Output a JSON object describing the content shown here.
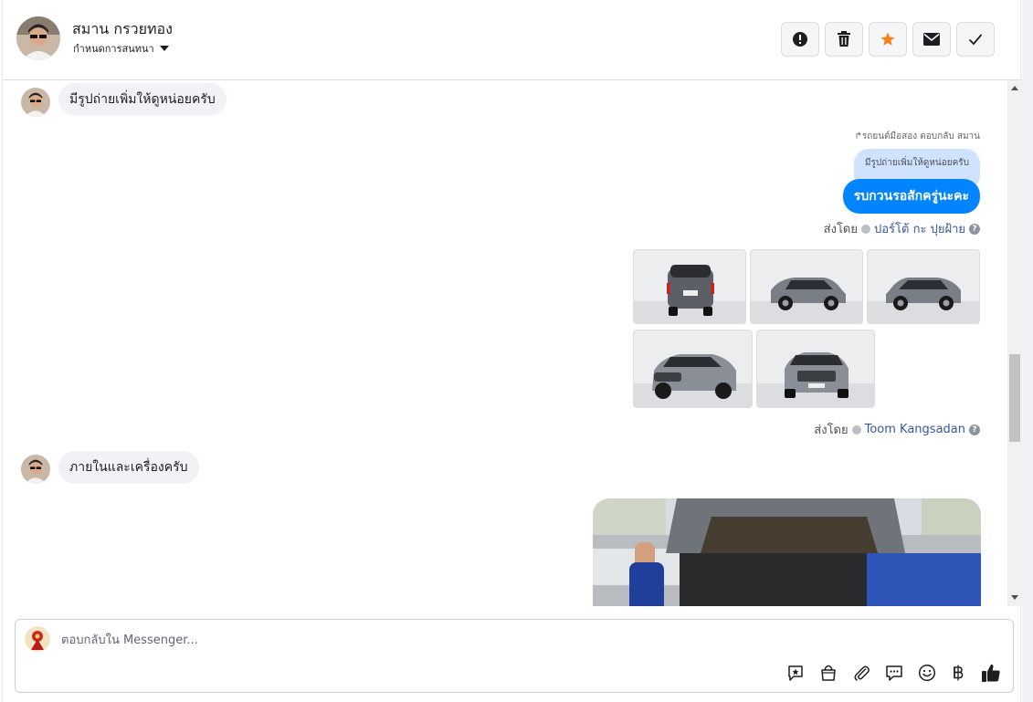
{
  "header": {
    "contact_name": "สมาน กรวยทอง",
    "subtitle": "กำหนดการสนทนา"
  },
  "messages": {
    "incoming_1": "มีรูปถ่ายเพิ่มให้ดูหน่อยครับ",
    "reply_meta": "รถยนต์มือสอง ตอบกลับ สมาน",
    "quoted_text": "มีรูปถ่ายเพิ่มให้ดูหน่อยครับ",
    "outgoing_1": "รบกวนรอสักครู่นะคะ",
    "sent_by_label": "ส่งโดย",
    "sender_1": "ปอร์โต้ กะ ปุยฝ้าย",
    "sender_2": "Toom Kangsadan",
    "incoming_2": "ภายในและเครื่องครับ"
  },
  "composer": {
    "placeholder": "ตอบกลับใน Messenger..."
  },
  "icons": {
    "header_actions": [
      "alert-icon",
      "trash-icon",
      "star-icon",
      "mail-icon",
      "check-icon"
    ],
    "composer_tools": [
      "saved-reply-icon",
      "shop-icon",
      "attach-icon",
      "chat-icon",
      "emoji-icon",
      "baht-icon",
      "like-icon"
    ]
  },
  "colors": {
    "accent_blue": "#0084ff",
    "star_orange": "#f5821f",
    "incoming_bubble": "#f0f2f5",
    "quoted_bubble": "#cfe3ff"
  }
}
